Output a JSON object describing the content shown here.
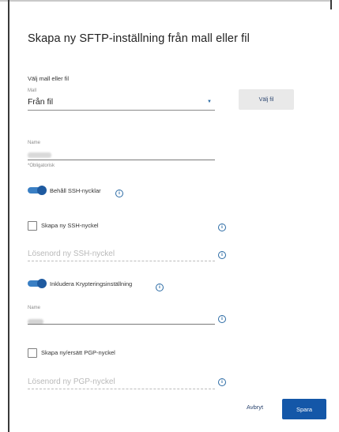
{
  "dialog": {
    "title": "Skapa ny SFTP-inställning från mall eller fil",
    "section_label": "Välj mall eller fil",
    "template": {
      "caption": "Mall",
      "value": "Från fil"
    },
    "choose_file_button": "Välj fil",
    "name_field": {
      "caption": "Name",
      "helper": "*Obligatorisk"
    },
    "keep_ssh_keys": {
      "label": "Behåll SSH-nycklar",
      "checked": true
    },
    "create_ssh_key": {
      "label": "Skapa ny SSH-nyckel",
      "checked": false
    },
    "ssh_password": {
      "placeholder": "Lösenord ny SSH-nyckel"
    },
    "include_encryption": {
      "label": "Inkludera Krypteringsinställning",
      "checked": true
    },
    "encryption_name": {
      "caption": "Name"
    },
    "create_pgp_key": {
      "label": "Skapa ny/ersätt PGP-nyckel",
      "checked": false
    },
    "pgp_password": {
      "placeholder": "Lösenord ny PGP-nyckel"
    },
    "cancel_button": "Avbryt",
    "save_button": "Spara"
  },
  "icons": {
    "info": "info-icon",
    "dropdown": "chevron-down-icon"
  },
  "colors": {
    "primary": "#1457a8",
    "toggle_on": "#3a7fc4",
    "info_icon": "#2a6aa4"
  }
}
